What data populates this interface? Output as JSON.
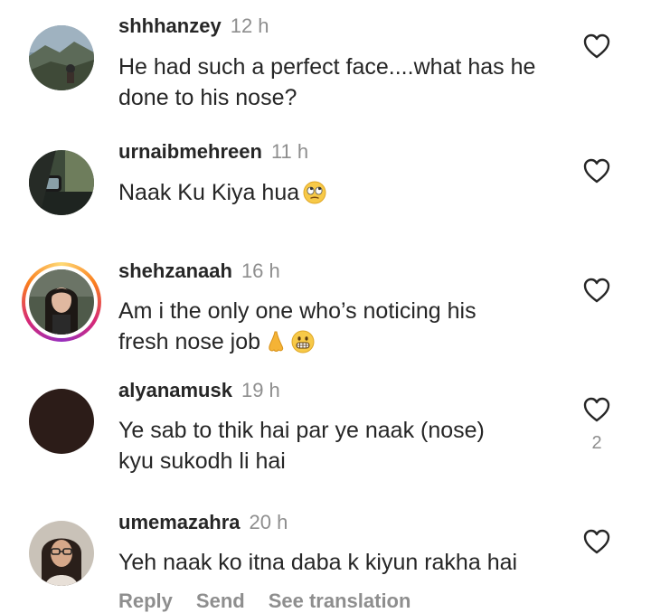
{
  "comments": [
    {
      "username": "shhhanzey",
      "time": "12 h",
      "text": "He had such a perfect face....what has he done to his nose?",
      "avatar": "avatar-mountain-landscape"
    },
    {
      "username": "urnaibmehreen",
      "time": "11 h",
      "text": "Naak Ku Kiya hua",
      "emoji": "eye-roll-emoji",
      "avatar": "avatar-car-mirror"
    },
    {
      "username": "shehzanaah",
      "time": "16 h",
      "text_line1": "Am i the only one who’s noticing his",
      "text_line2": "fresh nose job",
      "emoji": [
        "nose-emoji",
        "grimacing-emoji"
      ],
      "avatar": "avatar-woman-portrait",
      "story_ring": true
    },
    {
      "username": "alyanamusk",
      "time": "19 h",
      "text_line1": "Ye sab to thik hai par ye naak (nose)",
      "text_line2": "kyu sukodh li hai",
      "likes": "2",
      "avatar": "avatar-dark"
    },
    {
      "username": "umemazahra",
      "time": "20 h",
      "text": "Yeh naak ko itna daba k kiyun rakha hai",
      "avatar": "avatar-woman-glasses"
    }
  ],
  "actions": {
    "reply": "Reply",
    "send": "Send",
    "translate": "See translation"
  },
  "colors": {
    "username": "#262626",
    "time": "#8e8e8e",
    "text": "#262626",
    "action": "#8e8e8e"
  }
}
